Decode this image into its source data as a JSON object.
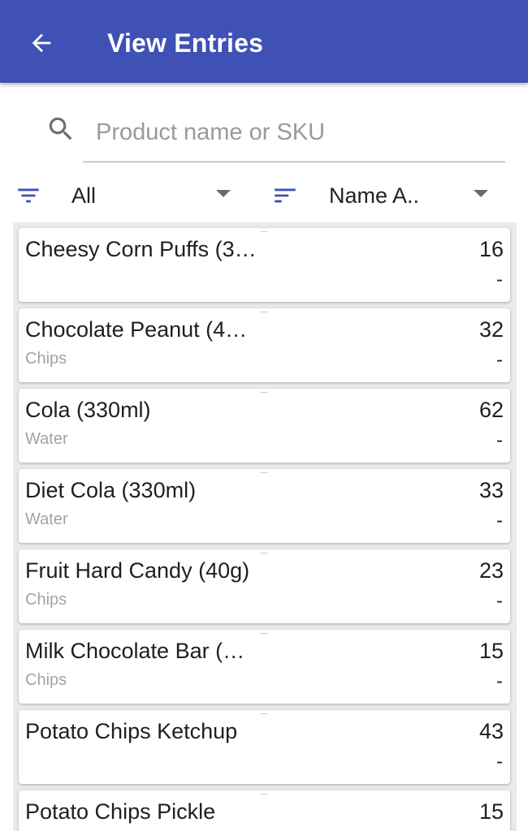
{
  "app_bar": {
    "title": "View Entries",
    "back_icon": "arrow-back-icon",
    "color": "#3f51b5"
  },
  "search": {
    "placeholder": "Product name or SKU",
    "value": "",
    "icon": "search-icon"
  },
  "filter": {
    "value": "All",
    "icon": "filter-icon"
  },
  "sort": {
    "value": "Name A..",
    "icon": "sort-icon"
  },
  "items": [
    {
      "name": "Cheesy Corn Puffs (3…",
      "category": "",
      "quantity": "16",
      "secondary": "-"
    },
    {
      "name": "Chocolate Peanut (4…",
      "category": "Chips",
      "quantity": "32",
      "secondary": "-"
    },
    {
      "name": "Cola (330ml)",
      "category": "Water",
      "quantity": "62",
      "secondary": "-"
    },
    {
      "name": "Diet Cola (330ml)",
      "category": "Water",
      "quantity": "33",
      "secondary": "-"
    },
    {
      "name": "Fruit Hard Candy (40g)",
      "category": "Chips",
      "quantity": "23",
      "secondary": "-"
    },
    {
      "name": "Milk Chocolate Bar (…",
      "category": "Chips",
      "quantity": "15",
      "secondary": "-"
    },
    {
      "name": "Potato Chips Ketchup",
      "category": "",
      "quantity": "43",
      "secondary": "-"
    },
    {
      "name": "Potato Chips Pickle",
      "category": "",
      "quantity": "15",
      "secondary": ""
    }
  ]
}
